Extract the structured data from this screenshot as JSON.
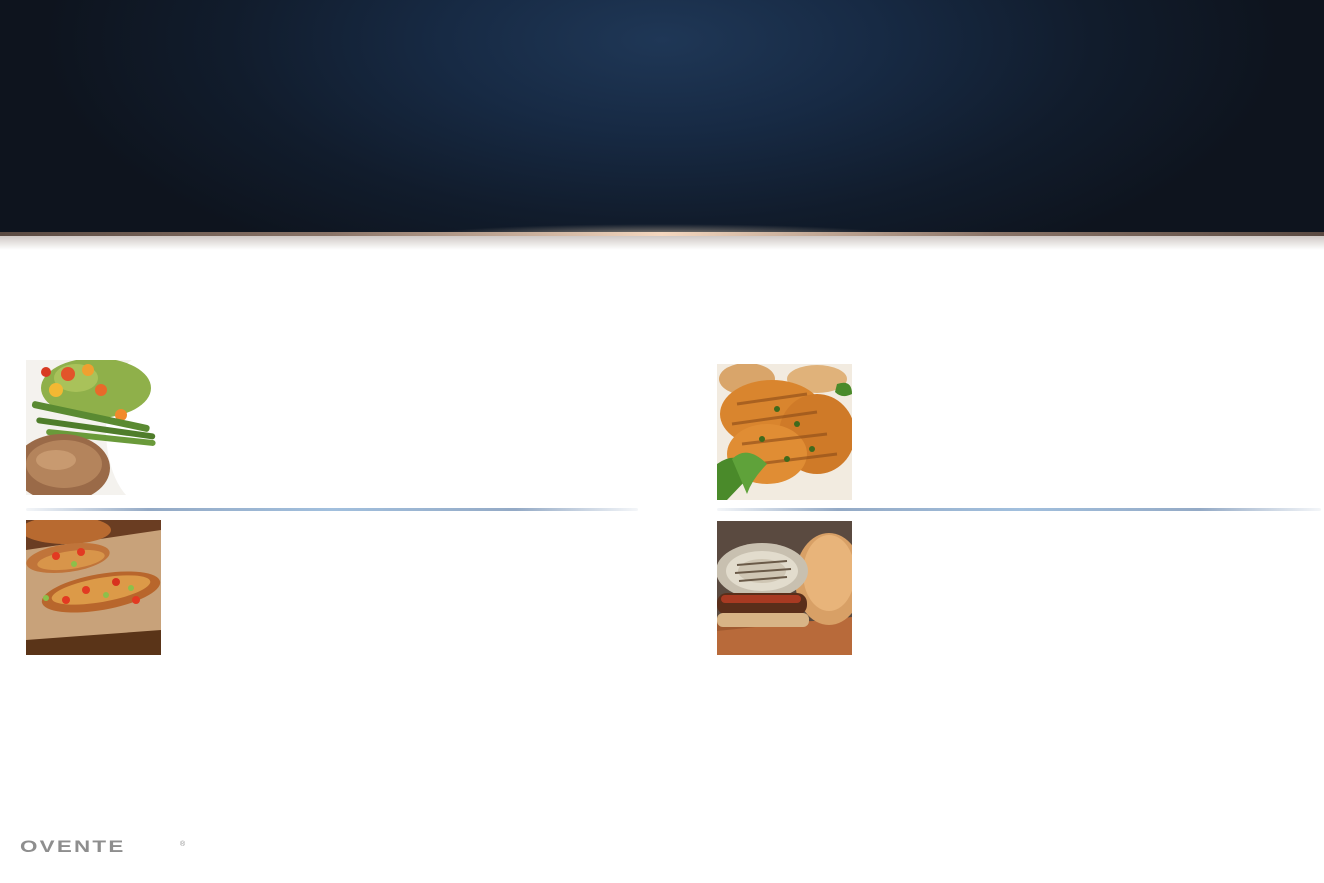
{
  "brand": {
    "logo_text": "OVENTE",
    "logo_mark": "®"
  },
  "foods": [
    {
      "name": "pork-chop-salad-asparagus"
    },
    {
      "name": "grilled-herb-chicken"
    },
    {
      "name": "loaded-potato-skins"
    },
    {
      "name": "grilled-burger-onion"
    }
  ],
  "colors": {
    "banner_dark": "#0e141e",
    "banner_light": "#1f3756",
    "divider_accent": "#82aad2",
    "logo_gray": "#8a8a8a"
  }
}
